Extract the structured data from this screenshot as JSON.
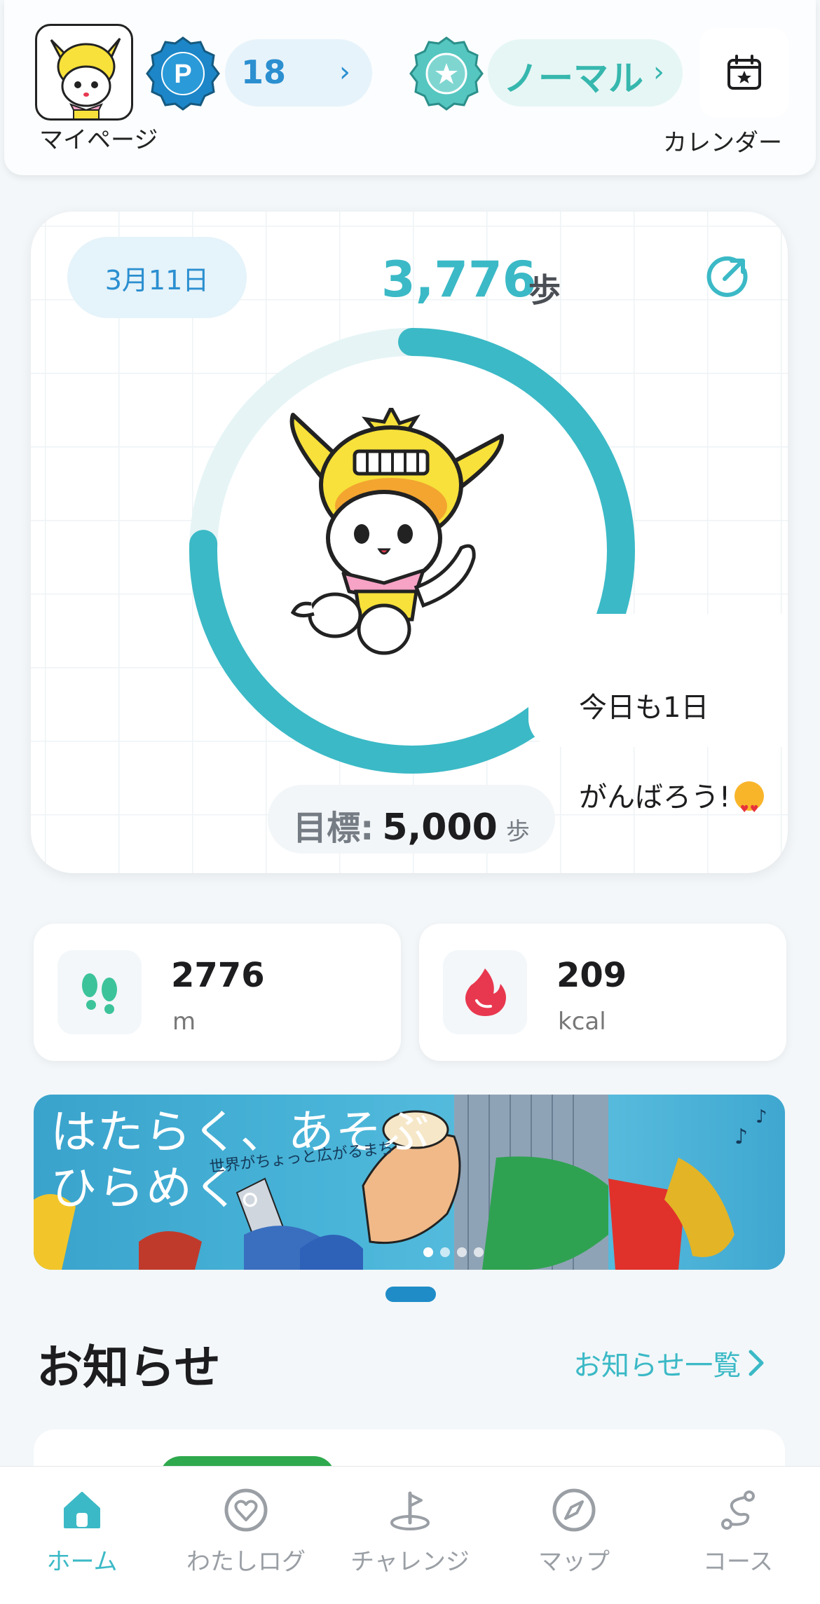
{
  "header": {
    "mypage_label": "マイページ",
    "points": {
      "badge_letter": "P",
      "value": "18"
    },
    "rank": {
      "label": "ノーマル"
    },
    "calendar_label": "カレンダー"
  },
  "steps_card": {
    "date": "3月11日",
    "steps_now": "3,776",
    "steps_unit": "歩",
    "progress_fraction": 0.7552,
    "bubble_line1": "今日も1日",
    "bubble_line2": "がんばろう!",
    "goal_label": "目標:",
    "goal_value": "5,000",
    "goal_unit": "歩"
  },
  "stats": {
    "distance": {
      "value": "2776",
      "unit": "m"
    },
    "calories": {
      "value": "209",
      "unit": "kcal"
    }
  },
  "banner": {
    "title": "はたらく、あそぶ\nひらめく。",
    "subtitle": "世界がちょっと広がるまち"
  },
  "news": {
    "title": "お知らせ",
    "link_label": "お知らせ一覧"
  },
  "nav": [
    {
      "label": "ホーム",
      "icon": "home-icon",
      "active": true
    },
    {
      "label": "わたしログ",
      "icon": "heart-circle-icon",
      "active": false
    },
    {
      "label": "チャレンジ",
      "icon": "flag-icon",
      "active": false
    },
    {
      "label": "マップ",
      "icon": "compass-icon",
      "active": false
    },
    {
      "label": "コース",
      "icon": "route-icon",
      "active": false
    }
  ],
  "colors": {
    "accent": "#3bb9c6",
    "point_blue": "#2b8fd0",
    "rank_teal": "#36b7ae",
    "ring_track": "#e6f4f5",
    "footprint_green": "#3cc39a",
    "flame_red": "#e8384f"
  }
}
